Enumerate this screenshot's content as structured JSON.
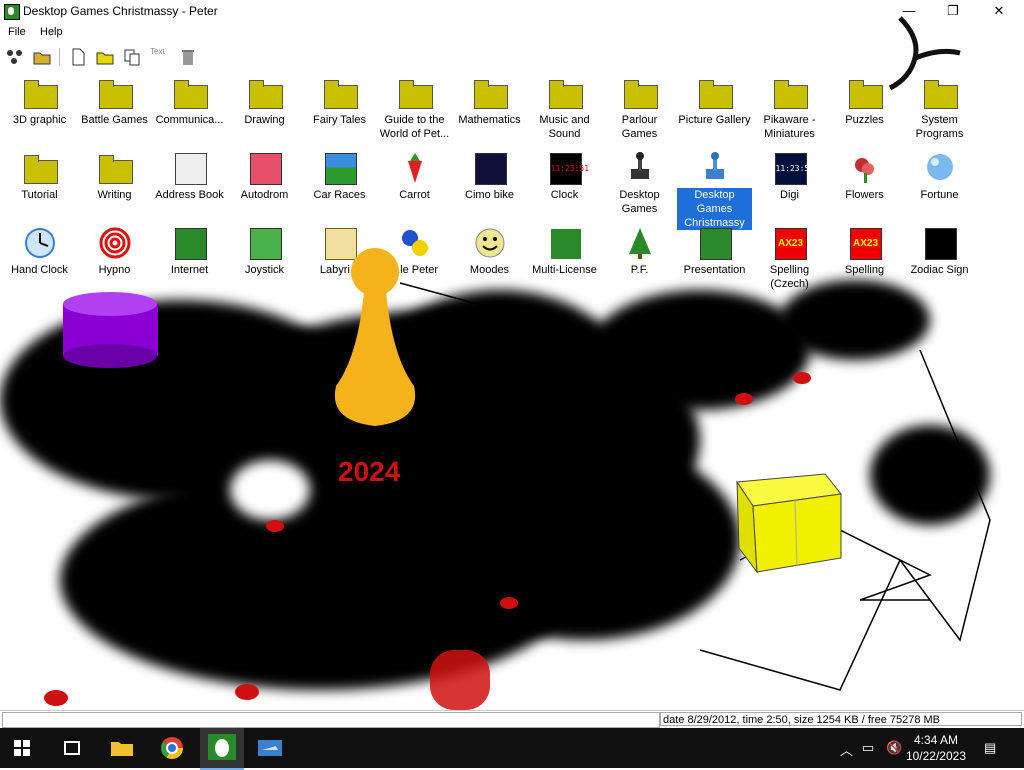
{
  "window": {
    "title": "Desktop Games Christmassy - Peter",
    "minimize": "—",
    "maximize": "❐",
    "close": "✕"
  },
  "menu": {
    "file": "File",
    "help": "Help"
  },
  "toolbar": {
    "text_label": "Text"
  },
  "items": [
    {
      "label": "3D graphic"
    },
    {
      "label": "Battle Games"
    },
    {
      "label": "Communica..."
    },
    {
      "label": "Drawing"
    },
    {
      "label": "Fairy Tales"
    },
    {
      "label": "Guide to the World of Pet..."
    },
    {
      "label": "Mathematics"
    },
    {
      "label": "Music and Sound"
    },
    {
      "label": "Parlour Games"
    },
    {
      "label": "Picture Gallery"
    },
    {
      "label": "Pikaware - Miniatures"
    },
    {
      "label": "Puzzles"
    },
    {
      "label": "System Programs"
    },
    {
      "label": "Tutorial"
    },
    {
      "label": "Writing"
    },
    {
      "label": "Address Book"
    },
    {
      "label": "Autodrom"
    },
    {
      "label": "Car Races"
    },
    {
      "label": "Carrot"
    },
    {
      "label": "Cimo bike"
    },
    {
      "label": "Clock"
    },
    {
      "label": "Desktop Games"
    },
    {
      "label": "Desktop Games Christmassy"
    },
    {
      "label": "Digi"
    },
    {
      "label": "Flowers"
    },
    {
      "label": "Fortune"
    },
    {
      "label": "Hand Clock"
    },
    {
      "label": "Hypno"
    },
    {
      "label": "Internet"
    },
    {
      "label": "Joystick"
    },
    {
      "label": "Labyri..."
    },
    {
      "label": "...le Peter"
    },
    {
      "label": "Moodes"
    },
    {
      "label": "Multi-License"
    },
    {
      "label": "P.F."
    },
    {
      "label": "Presentation"
    },
    {
      "label": "Spelling (Czech)"
    },
    {
      "label": "Spelling"
    },
    {
      "label": "Zodiac Sign"
    }
  ],
  "digi_text": "11:23:51",
  "clock_icon_text": "11:23:51",
  "spelling_icon_text": "AX23",
  "overlay_year": "2024",
  "status": {
    "right": "date 8/29/2012, time 2:50, size 1254 KB / free 75278 MB"
  },
  "taskbar": {
    "time": "4:34 AM",
    "date": "10/22/2023"
  },
  "colors": {
    "folder": "#c8c000",
    "selection": "#1e6fd9",
    "pawn": "#f5b21a",
    "year_text": "#d01010",
    "cylinder": "#8a00d4",
    "gift": "#f0f000"
  }
}
